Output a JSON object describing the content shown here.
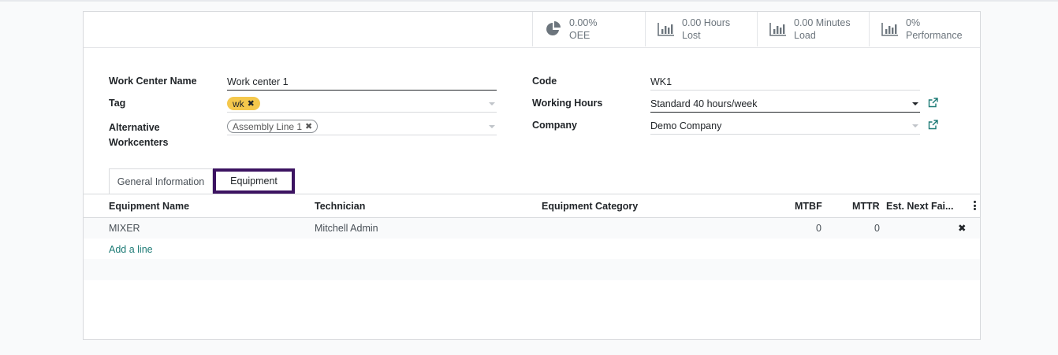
{
  "stats": [
    {
      "value": "0.00%",
      "label": "OEE",
      "icon": "pie-chart-icon"
    },
    {
      "value": "0.00 Hours",
      "label": "Lost",
      "icon": "bar-chart-icon"
    },
    {
      "value": "0.00 Minutes",
      "label": "Load",
      "icon": "bar-chart-icon"
    },
    {
      "value": "0%",
      "label": "Performance",
      "icon": "bar-chart-icon"
    }
  ],
  "form": {
    "work_center_name_label": "Work Center Name",
    "work_center_name_value": "Work center 1",
    "tag_label": "Tag",
    "tag_value": "wk",
    "alternative_label_1": "Alternative",
    "alternative_label_2": "Workcenters",
    "alternative_value": "Assembly Line 1",
    "code_label": "Code",
    "code_value": "WK1",
    "working_hours_label": "Working Hours",
    "working_hours_value": "Standard 40 hours/week",
    "company_label": "Company",
    "company_value": "Demo Company"
  },
  "tabs": {
    "general": "General Information",
    "equipment": "Equipment"
  },
  "table": {
    "columns": {
      "name": "Equipment Name",
      "technician": "Technician",
      "category": "Equipment Category",
      "mtbf": "MTBF",
      "mttr": "MTTR",
      "next": "Est. Next Fai..."
    },
    "rows": [
      {
        "name": "MIXER",
        "technician": "Mitchell Admin",
        "category": "",
        "mtbf": "0",
        "mttr": "0"
      }
    ],
    "add_line": "Add a line"
  },
  "colors": {
    "accent": "#1c7a75",
    "highlight": "#3c1361",
    "tag": "#f5c84c"
  }
}
